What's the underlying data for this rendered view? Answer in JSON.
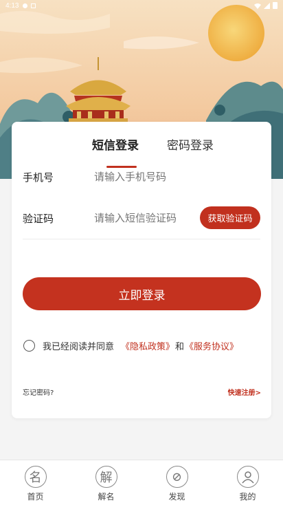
{
  "status_bar": {
    "time": "4:13"
  },
  "tabs": {
    "sms_login": "短信登录",
    "password_login": "密码登录"
  },
  "form": {
    "phone_label": "手机号",
    "phone_placeholder": "请输入手机号码",
    "code_label": "验证码",
    "code_placeholder": "请输入短信验证码",
    "get_code_button": "获取验证码",
    "login_button": "立即登录"
  },
  "agreement": {
    "prefix": "我已经阅读并同意",
    "privacy_link": "《隐私政策》",
    "conjunction": "和",
    "service_link": "《服务协议》"
  },
  "footer_links": {
    "forgot_password": "忘记密码?",
    "quick_register": "快速注册>"
  },
  "bottom_nav": [
    {
      "label": "首页",
      "icon": "name-seal-icon",
      "glyph": "名"
    },
    {
      "label": "解名",
      "icon": "interpret-icon",
      "glyph": "解"
    },
    {
      "label": "发现",
      "icon": "discover-icon",
      "glyph": "⊘"
    },
    {
      "label": "我的",
      "icon": "profile-icon",
      "glyph": ""
    }
  ],
  "colors": {
    "accent": "#c1301e",
    "banner_top": "#f6e3c6",
    "banner_sun": "#f2b84c"
  }
}
